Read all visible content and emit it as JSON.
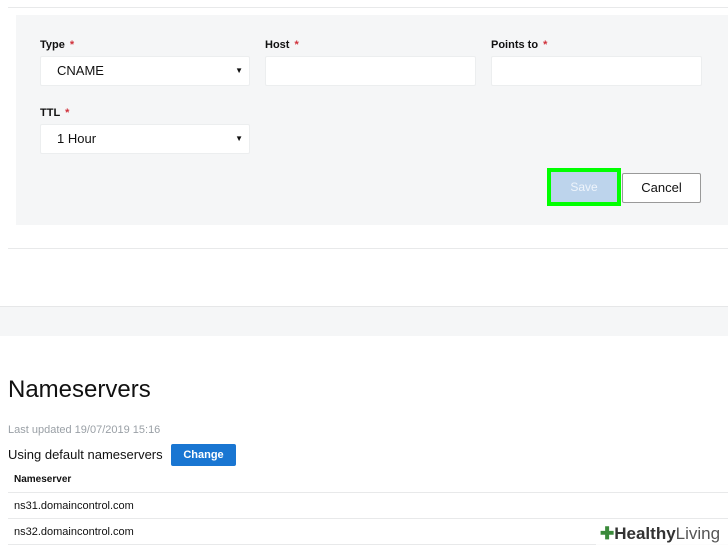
{
  "form": {
    "type_label": "Type",
    "type_value": "CNAME",
    "host_label": "Host",
    "host_value": "",
    "points_to_label": "Points to",
    "points_to_value": "",
    "ttl_label": "TTL",
    "ttl_value": "1 Hour",
    "required_mark": "*",
    "save_label": "Save",
    "cancel_label": "Cancel"
  },
  "nameservers": {
    "title": "Nameservers",
    "last_updated": "Last updated 19/07/2019 15:16",
    "status": "Using default nameservers",
    "change_label": "Change",
    "column_header": "Nameserver",
    "rows": [
      "ns31.domaincontrol.com",
      "ns32.domaincontrol.com"
    ]
  },
  "watermark": {
    "bold": "Healthy",
    "light": "Living"
  },
  "colors": {
    "accent": "#1976d2",
    "highlight": "#00ff00"
  }
}
